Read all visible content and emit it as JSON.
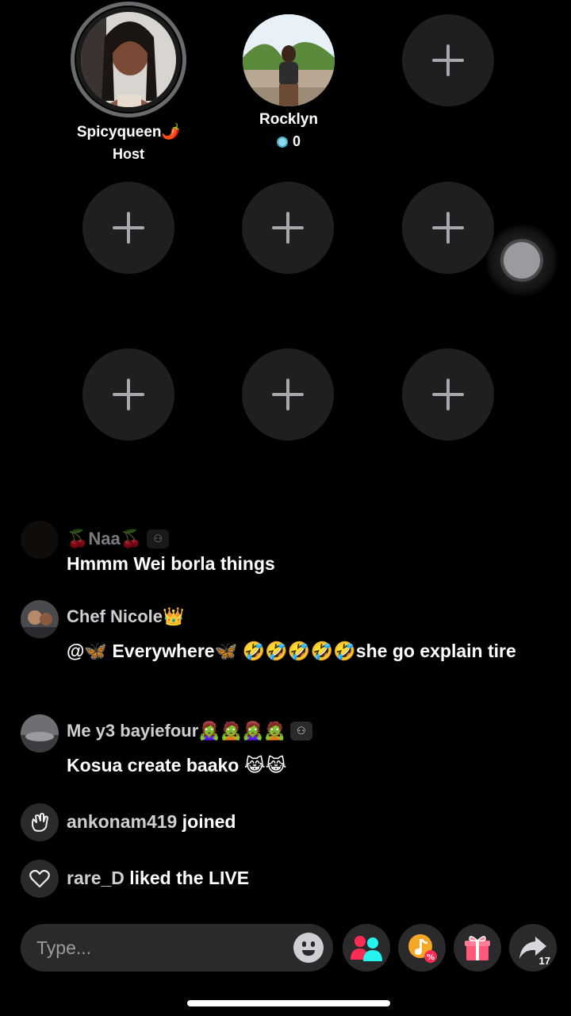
{
  "guests": [
    {
      "name": "Spicyqueen🌶️",
      "role": "Host"
    },
    {
      "name": "Rocklyn",
      "coins": "0"
    }
  ],
  "empty_slot_icon": "plus-icon",
  "chat": [
    {
      "user": "🍒Naa🍒",
      "message": "Hmmm Wei borla things"
    },
    {
      "user": "Chef Nicole👑",
      "message": "@🦋 Everywhere🦋 🤣🤣🤣🤣🤣she go explain tire"
    },
    {
      "user": "Me y3 bayiefour🧟‍♀️🧟🧟‍♀️🧟",
      "message": "Kosua create baako 😹😹"
    }
  ],
  "events": [
    {
      "icon": "wave-icon",
      "user": "ankonam419",
      "action": "joined"
    },
    {
      "icon": "heart-icon",
      "user": "rare_D",
      "action": "liked the LIVE"
    }
  ],
  "input": {
    "placeholder": "Type..."
  },
  "actions": {
    "share_count": "17"
  },
  "colors": {
    "background": "#000000",
    "slot": "#1f1f21",
    "accent": "#fe2c55",
    "teal": "#25f4ee"
  }
}
